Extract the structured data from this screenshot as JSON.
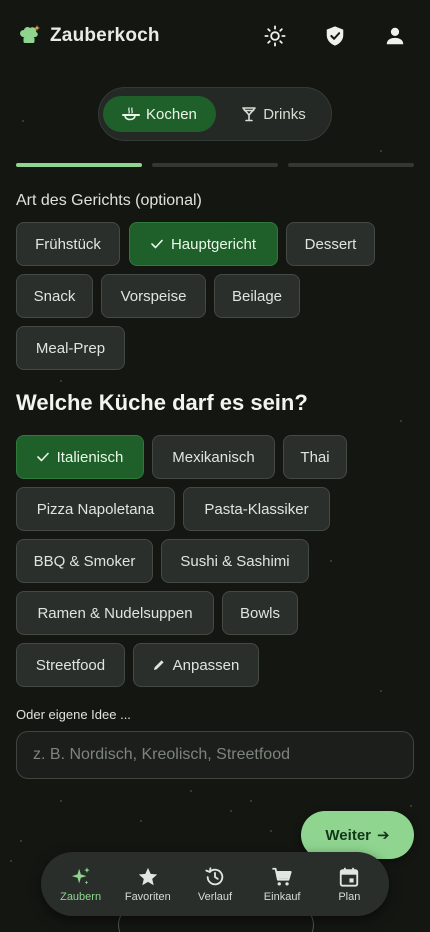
{
  "app": {
    "title": "Zauberkoch"
  },
  "colors": {
    "accent": "#8fd590",
    "selected": "#1e5f2a",
    "background": "#141612"
  },
  "header": {
    "icons": [
      "sun-icon",
      "shield-check-icon",
      "user-icon"
    ]
  },
  "mode": {
    "kochen": "Kochen",
    "drinks": "Drinks"
  },
  "progress": {
    "steps_total": 3,
    "steps_done": 1
  },
  "dish_type": {
    "label": "Art des Gerichts (optional)",
    "options": [
      "Frühstück",
      "Hauptgericht",
      "Dessert",
      "Snack",
      "Vorspeise",
      "Beilage",
      "Meal-Prep"
    ],
    "selected": "Hauptgericht"
  },
  "cuisine": {
    "heading": "Welche Küche darf es sein?",
    "options": [
      "Italienisch",
      "Mexikanisch",
      "Thai",
      "Pizza Napoletana",
      "Pasta-Klassiker",
      "BBQ & Smoker",
      "Sushi & Sashimi",
      "Ramen & Nudelsuppen",
      "Bowls",
      "Streetfood"
    ],
    "selected": "Italienisch",
    "customize": "Anpassen"
  },
  "own_idea": {
    "label": "Oder eigene Idee ...",
    "placeholder": "z. B. Nordisch, Kreolisch, Streetfood",
    "value": ""
  },
  "next_button": {
    "label": "Weiter",
    "arrow": "➔"
  },
  "nav": [
    {
      "label": "Zaubern",
      "icon": "sparkle-icon",
      "active": true
    },
    {
      "label": "Favoriten",
      "icon": "star-icon"
    },
    {
      "label": "Verlauf",
      "icon": "history-icon"
    },
    {
      "label": "Einkauf",
      "icon": "cart-icon"
    },
    {
      "label": "Plan",
      "icon": "calendar-icon"
    }
  ]
}
